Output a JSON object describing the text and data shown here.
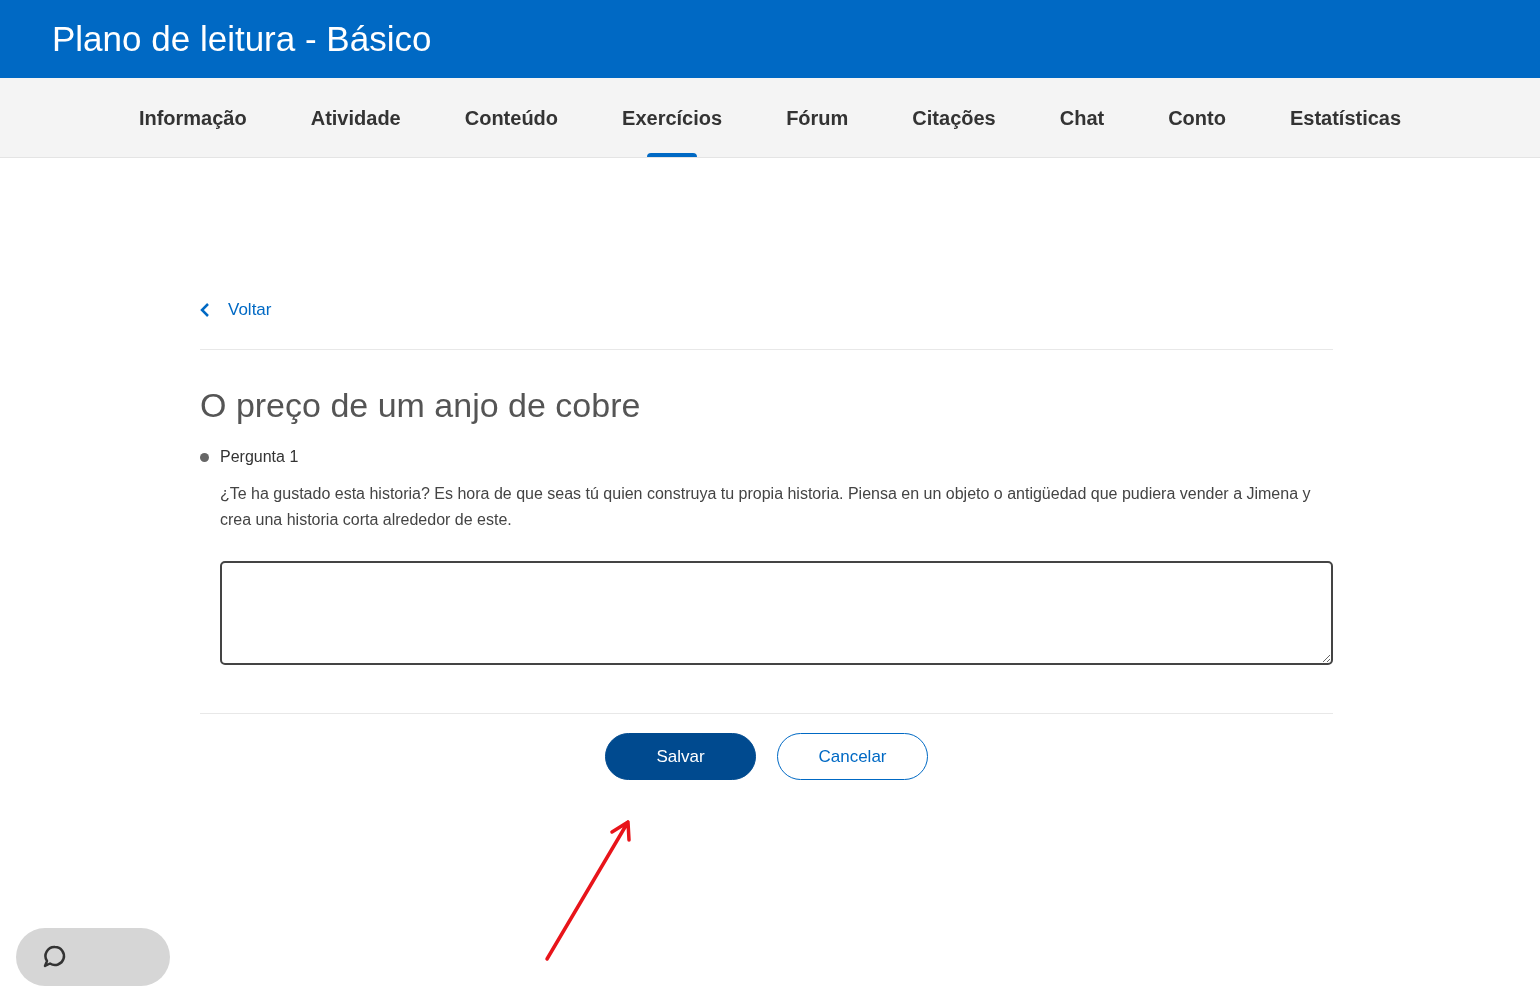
{
  "header": {
    "title": "Plano de leitura - Básico"
  },
  "tabs": [
    {
      "label": "Informação",
      "selected": false
    },
    {
      "label": "Atividade",
      "selected": false
    },
    {
      "label": "Conteúdo",
      "selected": false
    },
    {
      "label": "Exercícios",
      "selected": true
    },
    {
      "label": "Fórum",
      "selected": false
    },
    {
      "label": "Citações",
      "selected": false
    },
    {
      "label": "Chat",
      "selected": false
    },
    {
      "label": "Conto",
      "selected": false
    },
    {
      "label": "Estatísticas",
      "selected": false
    }
  ],
  "back_link": "Voltar",
  "exercise_title": "O preço de um anjo de cobre",
  "question": {
    "label": "Pergunta 1",
    "text": "¿Te ha gustado esta historia? Es hora de que seas tú quien construya tu propia historia. Piensa en un objeto o antigüedad que pudiera vender a Jimena y crea una historia corta alrededor de este."
  },
  "buttons": [
    {
      "label": "Salvar",
      "kind": "primary"
    },
    {
      "label": "Cancelar",
      "kind": "secondary"
    }
  ]
}
